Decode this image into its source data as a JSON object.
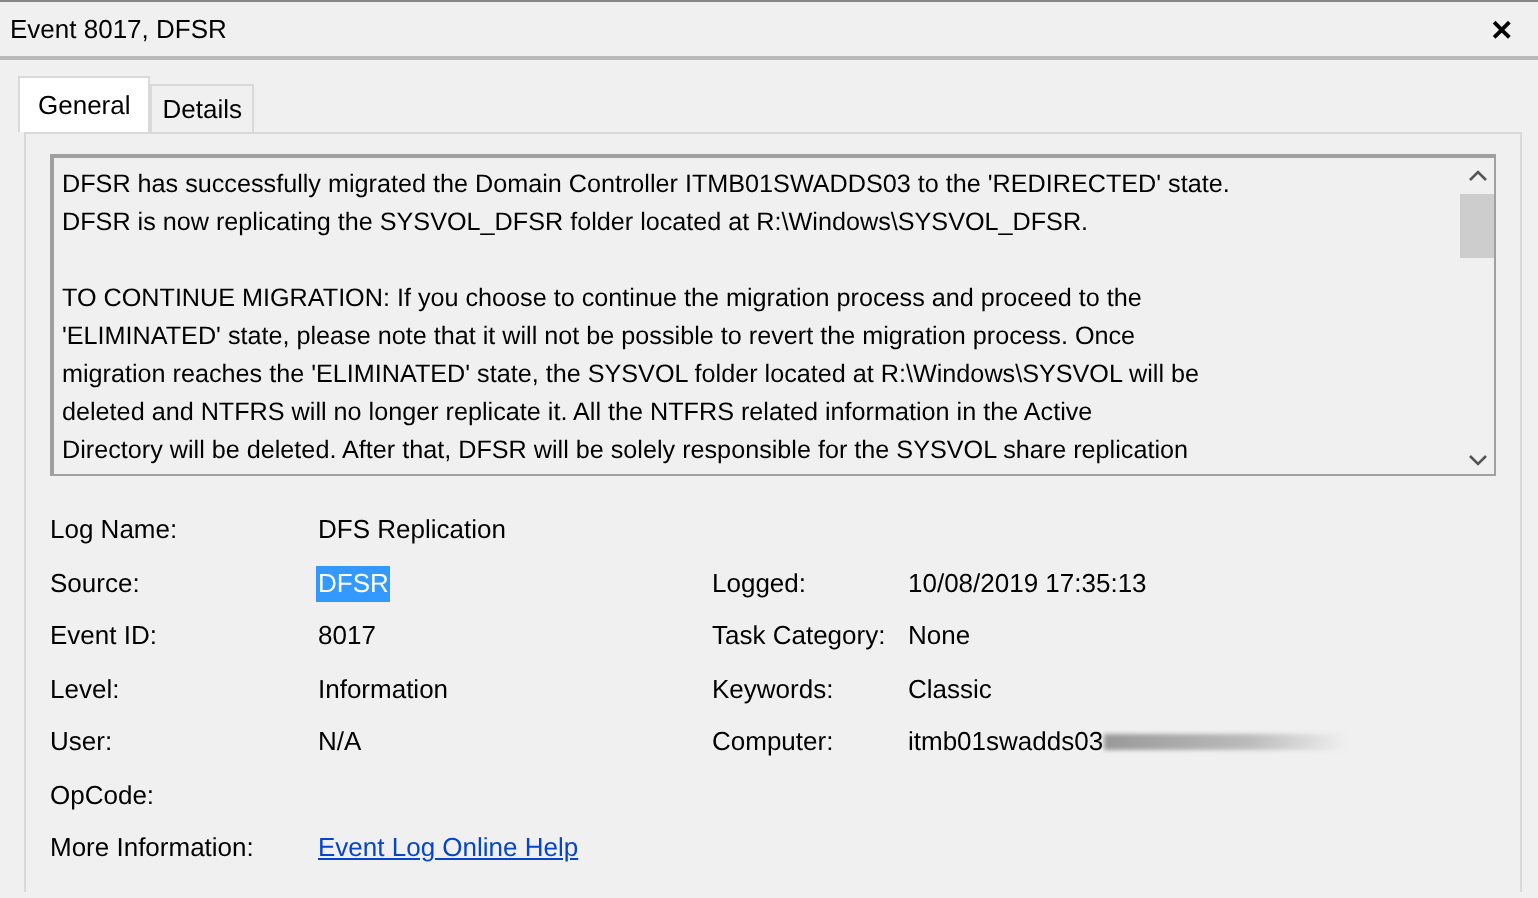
{
  "window": {
    "title": "Event 8017, DFSR",
    "close": "✕"
  },
  "tabs": [
    {
      "label": "General",
      "selected": true
    },
    {
      "label": "Details",
      "selected": false
    }
  ],
  "description": {
    "paragraphs": [
      [
        "DFSR has successfully migrated the Domain Controller ITMB01SWADDS03 to the 'REDIRECTED' state.",
        "DFSR is now replicating the SYSVOL_DFSR folder located at R:\\Windows\\SYSVOL_DFSR."
      ],
      [
        "TO CONTINUE MIGRATION: If you choose to continue the migration process and proceed to the",
        "'ELIMINATED' state, please note that it will not be possible to revert the migration process. Once",
        "migration reaches the 'ELIMINATED' state, the SYSVOL folder located at R:\\Windows\\SYSVOL will be",
        "deleted and NTFRS will no longer replicate it. All the NTFRS related information in the Active",
        "Directory will be deleted. After that, DFSR will be solely responsible for the SYSVOL share replication"
      ]
    ]
  },
  "fields": [
    {
      "label": "Log Name:",
      "value": "DFS Replication",
      "selected": false
    },
    {
      "label": "Source:",
      "value": "DFSR",
      "selected": true,
      "right": {
        "label": "Logged:",
        "value": "10/08/2019 17:35:13",
        "redacted": false
      }
    },
    {
      "label": "Event ID:",
      "value": "8017",
      "selected": false,
      "right": {
        "label": "Task Category:",
        "value": "None",
        "redacted": false
      }
    },
    {
      "label": "Level:",
      "value": "Information",
      "selected": false,
      "right": {
        "label": "Keywords:",
        "value": "Classic",
        "redacted": false
      }
    },
    {
      "label": "User:",
      "value": "N/A",
      "selected": false,
      "right": {
        "label": "Computer:",
        "value": "itmb01swadds03",
        "redacted": true
      }
    },
    {
      "label": "OpCode:",
      "selected": false
    },
    {
      "label": "More Information:",
      "value": "Event Log Online Help",
      "kind": "link",
      "selected": false
    }
  ]
}
